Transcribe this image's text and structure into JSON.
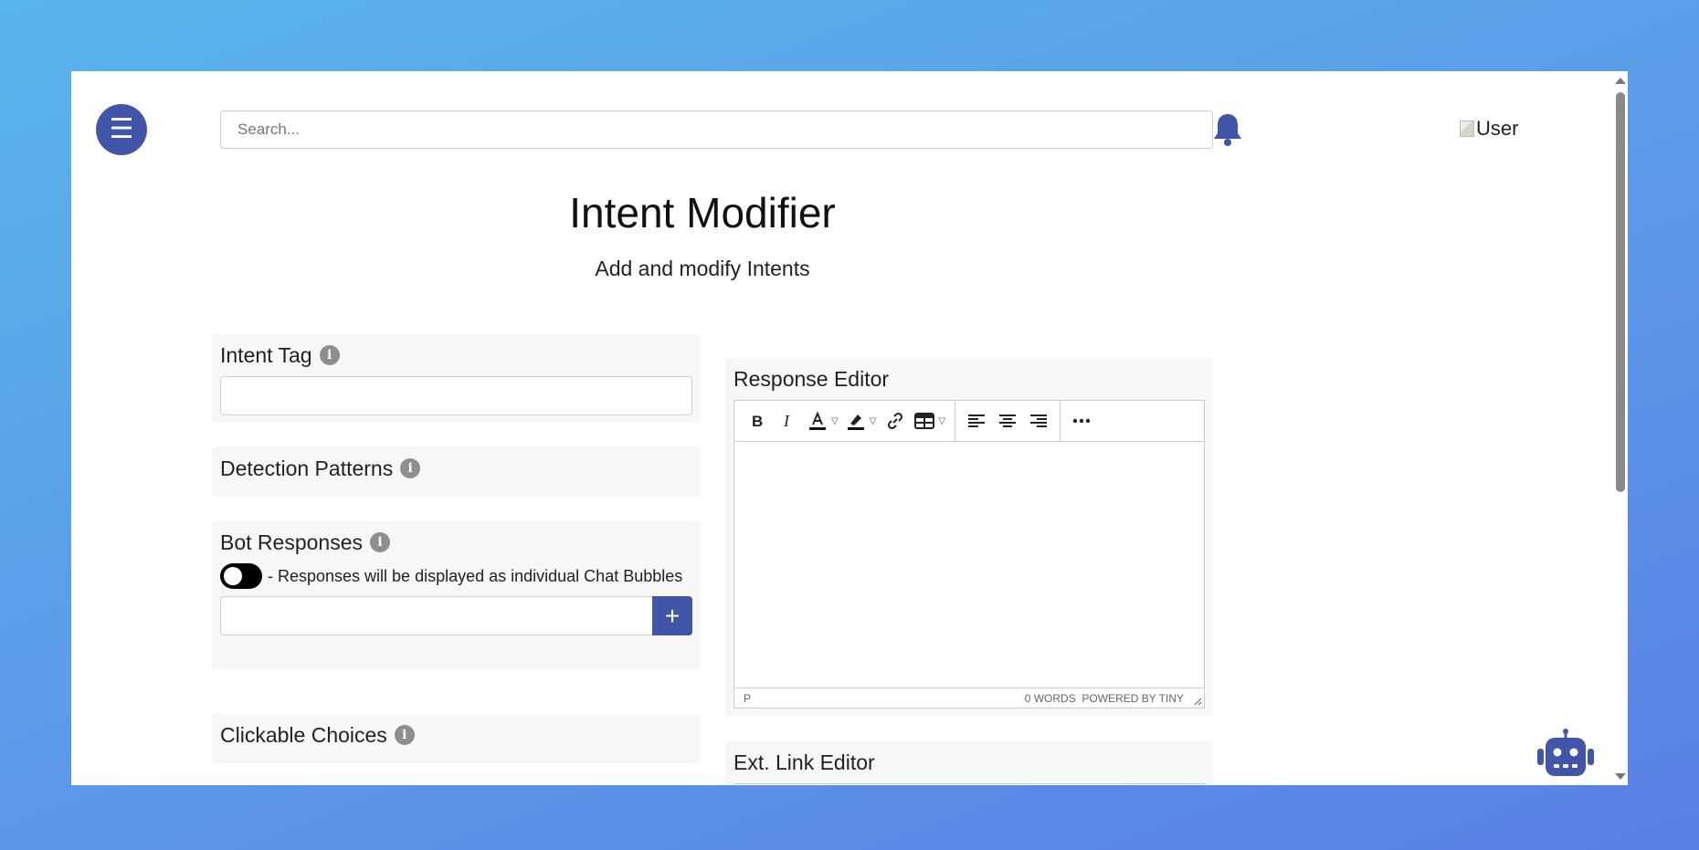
{
  "header": {
    "menu_icon": "hamburger-icon",
    "search_placeholder": "Search...",
    "bell_icon": "bell-icon",
    "user_alt": "User"
  },
  "page": {
    "title": "Intent Modifier",
    "subtitle": "Add and modify Intents"
  },
  "left_panels": {
    "intent_tag": {
      "label": "Intent Tag",
      "info": "i"
    },
    "detection_patterns": {
      "label": "Detection Patterns",
      "info": "i"
    },
    "bot_responses": {
      "label": "Bot Responses",
      "info": "i",
      "toggle_text": "- Responses will be displayed as individual Chat Bubbles",
      "toggle_on": false,
      "add_label": "+"
    },
    "clickable_choices": {
      "label": "Clickable Choices",
      "info": "i"
    }
  },
  "response_editor": {
    "label": "Response Editor",
    "toolbar": [
      "bold",
      "italic",
      "text-color",
      "highlight",
      "link",
      "table",
      "align-left",
      "align-center",
      "align-right",
      "more"
    ],
    "status_element": "P",
    "word_count": "0 WORDS",
    "powered_by": "POWERED BY TINY"
  },
  "ext_link_editor": {
    "label": "Ext. Link Editor"
  },
  "colors": {
    "accent": "#4156a8",
    "panel_bg": "#f7f7f8",
    "background_gradient": [
      "#59b4ea",
      "#5a7fe6"
    ]
  },
  "chatbot_icon": "robot-icon"
}
